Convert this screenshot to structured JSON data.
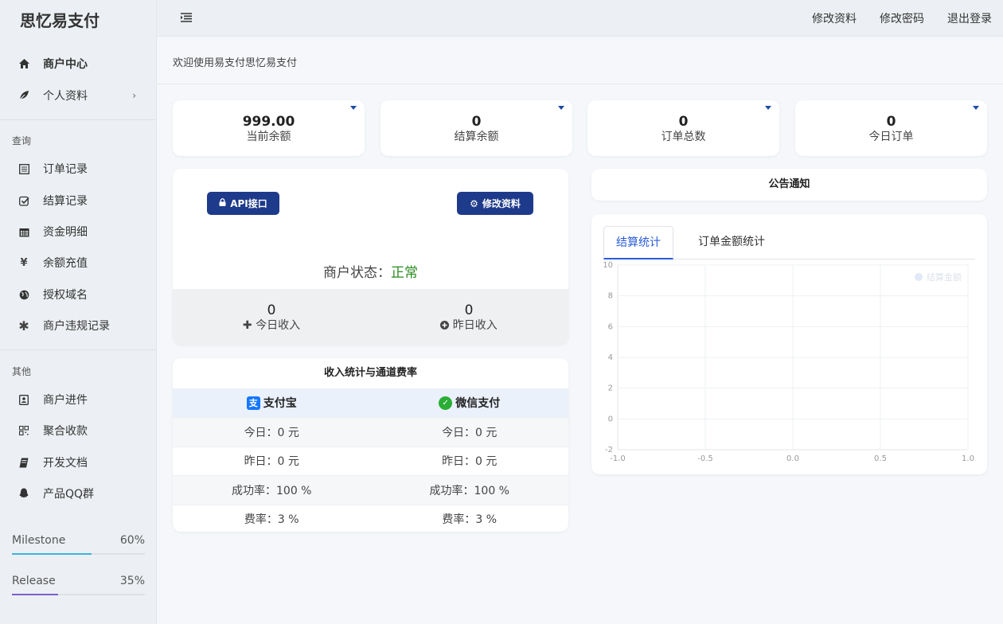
{
  "brand": "思忆易支付",
  "sidebar": {
    "items_top": [
      {
        "label": "商户中心",
        "icon": "home-icon"
      },
      {
        "label": "个人资料",
        "icon": "leaf-icon",
        "chevron": "›"
      }
    ],
    "section_query": "查询",
    "items_query": [
      {
        "label": "订单记录",
        "icon": "list-icon"
      },
      {
        "label": "结算记录",
        "icon": "check-square-icon"
      },
      {
        "label": "资金明细",
        "icon": "calendar-icon"
      },
      {
        "label": "余额充值",
        "icon": "yen-icon"
      },
      {
        "label": "授权域名",
        "icon": "globe-icon"
      },
      {
        "label": "商户违规记录",
        "icon": "asterisk-icon"
      }
    ],
    "section_other": "其他",
    "items_other": [
      {
        "label": "商户进件",
        "icon": "contact-icon"
      },
      {
        "label": "聚合收款",
        "icon": "qrcode-icon"
      },
      {
        "label": "开发文档",
        "icon": "book-icon"
      },
      {
        "label": "产品QQ群",
        "icon": "qq-icon"
      }
    ],
    "progress": [
      {
        "label": "Milestone",
        "value": "60%",
        "fraction": 0.6,
        "color": "#3ab5d8"
      },
      {
        "label": "Release",
        "value": "35%",
        "fraction": 0.35,
        "color": "#7a5fd1"
      }
    ]
  },
  "topbar": {
    "links": [
      "修改资料",
      "修改密码",
      "退出登录"
    ]
  },
  "welcome": "欢迎使用易支付思忆易支付",
  "stats": [
    {
      "value": "999.00",
      "label": "当前余额"
    },
    {
      "value": "0",
      "label": "结算余额"
    },
    {
      "value": "0",
      "label": "订单总数"
    },
    {
      "value": "0",
      "label": "今日订单"
    }
  ],
  "merchant": {
    "api_button": "API接口",
    "edit_button": "修改资料",
    "status_label": "商户状态：",
    "status_value": "正常",
    "today_income_value": "0",
    "today_income_label": "今日收入",
    "yesterday_income_value": "0",
    "yesterday_income_label": "昨日收入"
  },
  "rates": {
    "title": "收入统计与通道费率",
    "alipay": "支付宝",
    "wechat": "微信支付",
    "rows": [
      [
        "今日：0 元",
        "今日：0 元"
      ],
      [
        "昨日：0 元",
        "昨日：0 元"
      ],
      [
        "成功率：100 %",
        "成功率：100 %"
      ],
      [
        "费率：3 %",
        "费率：3 %"
      ]
    ]
  },
  "notice_title": "公告通知",
  "chart_tabs": [
    "结算统计",
    "订单金额统计"
  ],
  "chart_data": {
    "type": "line",
    "series": [
      {
        "name": "结算金额",
        "values": []
      }
    ],
    "xlim": [
      -1.0,
      1.0
    ],
    "ylim": [
      -2,
      10
    ],
    "xticks": [
      "-1.0",
      "-0.5",
      "0.0",
      "0.5",
      "1.0"
    ],
    "yticks": [
      "10",
      "8",
      "6",
      "4",
      "2",
      "0",
      "-2"
    ],
    "legend": "top-right",
    "grid": true
  }
}
